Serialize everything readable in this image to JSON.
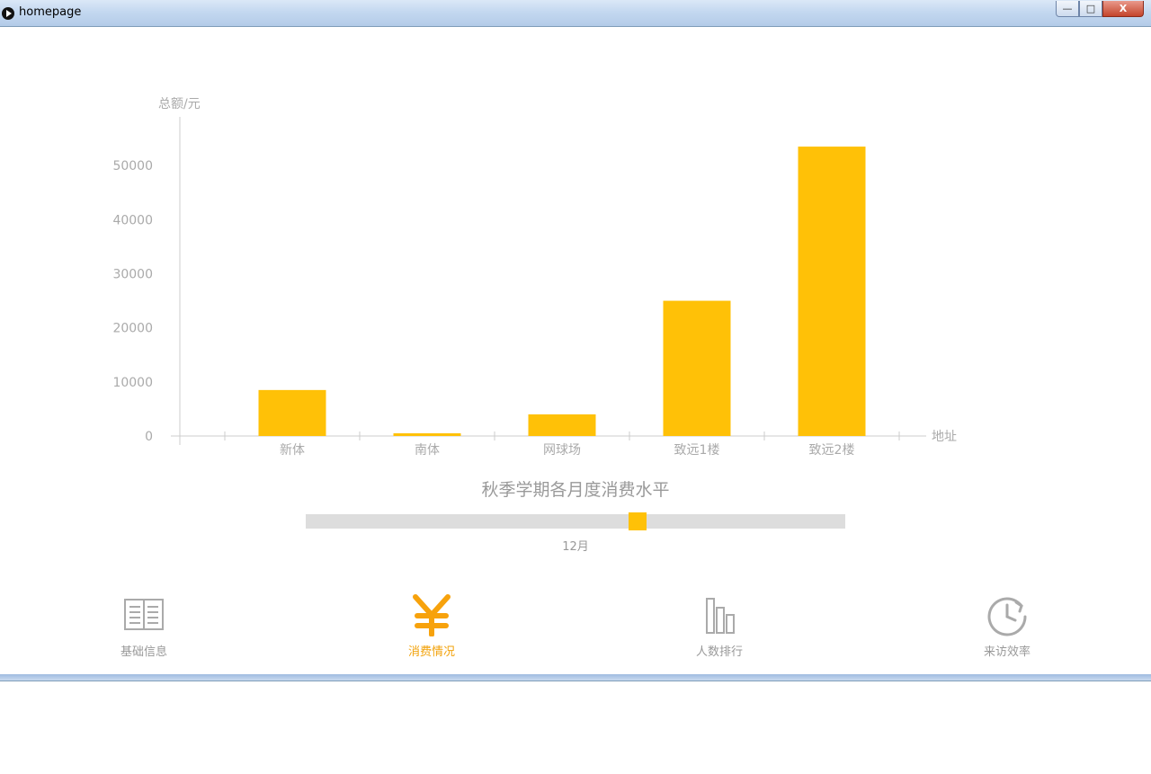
{
  "window": {
    "title": "homepage",
    "controls": {
      "minimize": "—",
      "maximize": "□",
      "close": "X"
    }
  },
  "chart_data": {
    "type": "bar",
    "title": "秋季学期各月度消费水平",
    "xlabel": "地址",
    "ylabel": "总额/元",
    "categories": [
      "新体",
      "南体",
      "网球场",
      "致远1楼",
      "致远2楼"
    ],
    "values": [
      8500,
      500,
      4000,
      25000,
      53500
    ],
    "ylim": [
      0,
      59000
    ],
    "yticks": [
      0,
      10000,
      20000,
      30000,
      40000,
      50000
    ],
    "bar_color": "#ffc107",
    "grid": false
  },
  "slider": {
    "label": "12月",
    "value": 0.615
  },
  "nav": [
    {
      "label": "基础信息",
      "icon": "book-icon",
      "active": false
    },
    {
      "label": "消费情况",
      "icon": "yen-icon",
      "active": true
    },
    {
      "label": "人数排行",
      "icon": "bar-chart-icon",
      "active": false
    },
    {
      "label": "来访效率",
      "icon": "clock-icon",
      "active": false
    }
  ],
  "colors": {
    "accent": "#ffc107",
    "active_nav": "#f2a20a",
    "muted": "#999999"
  }
}
